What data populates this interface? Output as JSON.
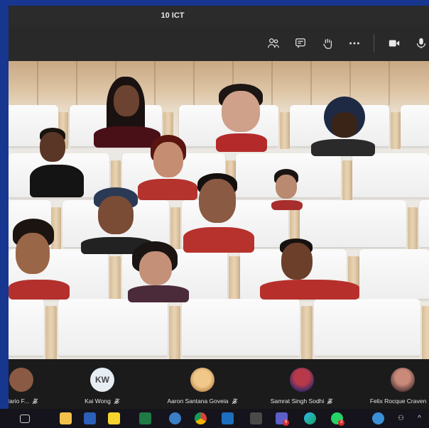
{
  "window": {
    "title": "10 ICT"
  },
  "toolbar": {
    "icons": [
      "people-icon",
      "chat-icon",
      "raise-hand-icon",
      "more-icon",
      "camera-icon",
      "microphone-icon"
    ]
  },
  "stage": {
    "mode": "together-mode-auditorium",
    "participant_count_visible": 12
  },
  "participants_strip": [
    {
      "name": "Mario F...",
      "muted": true,
      "avatar": "photo"
    },
    {
      "name": "Kai Wong",
      "muted": true,
      "avatar": "initials",
      "initials": "KW",
      "avatar_color": "#e6edf3"
    },
    {
      "name": "Aaron Santana Goveia",
      "muted": true,
      "avatar": "photo-doge"
    },
    {
      "name": "Samrat Singh Sodhi",
      "muted": true,
      "avatar": "photo"
    },
    {
      "name": "Felix Rocque Craven",
      "muted": true,
      "avatar": "photo"
    }
  ],
  "taskbar": {
    "apps": [
      "task-view",
      "file-explorer",
      "word",
      "sticky-notes",
      "excel",
      "app",
      "chrome",
      "outlook",
      "calculator",
      "teams",
      "edge",
      "whatsapp",
      "help",
      "people"
    ],
    "badges": {
      "teams": "9",
      "whatsapp": "3"
    }
  },
  "colors": {
    "desktop": "#16368f",
    "window_bg": "#1f1f1f",
    "toolbar": "#292929"
  }
}
